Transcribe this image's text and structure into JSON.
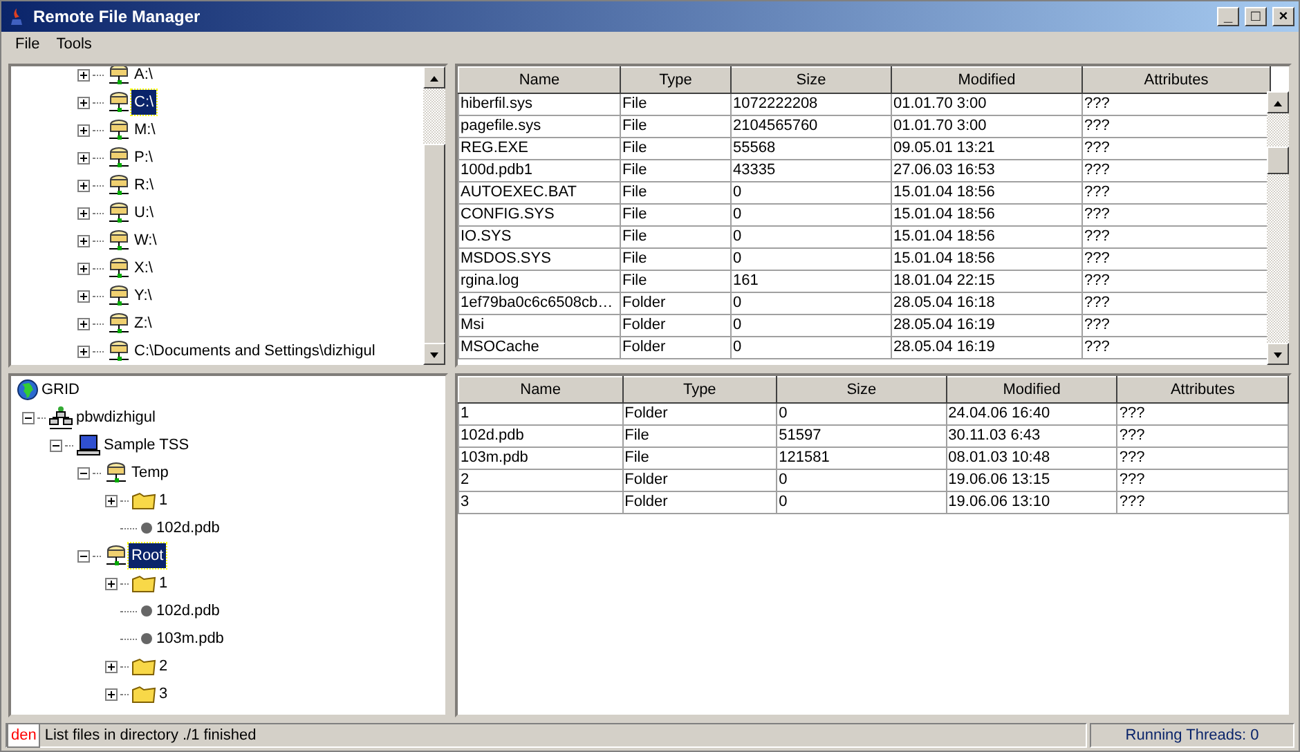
{
  "window": {
    "title": "Remote File Manager",
    "controls": [
      "_",
      "□",
      "×"
    ]
  },
  "menu": [
    "File",
    "Tools"
  ],
  "drive_tree": {
    "items": [
      {
        "label": "A:\\",
        "kind": "drive",
        "expanded": false,
        "selected": false
      },
      {
        "label": "C:\\",
        "kind": "drive",
        "expanded": false,
        "selected": true
      },
      {
        "label": "M:\\",
        "kind": "drive",
        "expanded": false,
        "selected": false
      },
      {
        "label": "P:\\",
        "kind": "drive",
        "expanded": false,
        "selected": false
      },
      {
        "label": "R:\\",
        "kind": "drive",
        "expanded": false,
        "selected": false
      },
      {
        "label": "U:\\",
        "kind": "drive",
        "expanded": false,
        "selected": false
      },
      {
        "label": "W:\\",
        "kind": "drive",
        "expanded": false,
        "selected": false
      },
      {
        "label": "X:\\",
        "kind": "drive",
        "expanded": false,
        "selected": false
      },
      {
        "label": "Y:\\",
        "kind": "drive",
        "expanded": false,
        "selected": false
      },
      {
        "label": "Z:\\",
        "kind": "drive",
        "expanded": false,
        "selected": false
      },
      {
        "label": "C:\\Documents and Settings\\dizhigul",
        "kind": "drive",
        "expanded": false,
        "selected": false
      }
    ]
  },
  "local_table": {
    "columns": [
      "Name",
      "Type",
      "Size",
      "Modified",
      "Attributes"
    ],
    "rows": [
      [
        "hiberfil.sys",
        "File",
        "1072222208",
        "01.01.70 3:00",
        "???"
      ],
      [
        "pagefile.sys",
        "File",
        "2104565760",
        "01.01.70 3:00",
        "???"
      ],
      [
        "REG.EXE",
        "File",
        "55568",
        "09.05.01 13:21",
        "???"
      ],
      [
        "100d.pdb1",
        "File",
        "43335",
        "27.06.03 16:53",
        "???"
      ],
      [
        "AUTOEXEC.BAT",
        "File",
        "0",
        "15.01.04 18:56",
        "???"
      ],
      [
        "CONFIG.SYS",
        "File",
        "0",
        "15.01.04 18:56",
        "???"
      ],
      [
        "IO.SYS",
        "File",
        "0",
        "15.01.04 18:56",
        "???"
      ],
      [
        "MSDOS.SYS",
        "File",
        "0",
        "15.01.04 18:56",
        "???"
      ],
      [
        "rgina.log",
        "File",
        "161",
        "18.01.04 22:15",
        "???"
      ],
      [
        "1ef79ba0c6c6508cb…",
        "Folder",
        "0",
        "28.05.04 16:18",
        "???"
      ],
      [
        "Msi",
        "Folder",
        "0",
        "28.05.04 16:19",
        "???"
      ],
      [
        "MSOCache",
        "Folder",
        "0",
        "28.05.04 16:19",
        "???"
      ]
    ]
  },
  "grid_tree": {
    "items": [
      {
        "label": "GRID",
        "kind": "globe",
        "selected": false,
        "children": [
          {
            "label": "pbwdizhigul",
            "kind": "network",
            "expanded": true,
            "selected": false,
            "children": [
              {
                "label": "Sample TSS",
                "kind": "computer",
                "expanded": true,
                "selected": false,
                "children": [
                  {
                    "label": "Temp",
                    "kind": "drive",
                    "expanded": true,
                    "selected": false,
                    "children": [
                      {
                        "label": "1",
                        "kind": "folder",
                        "expanded": false,
                        "selected": false
                      },
                      {
                        "label": "102d.pdb",
                        "kind": "file",
                        "selected": false
                      }
                    ]
                  },
                  {
                    "label": "Root",
                    "kind": "drive",
                    "expanded": true,
                    "selected": true,
                    "children": [
                      {
                        "label": "1",
                        "kind": "folder",
                        "expanded": false,
                        "selected": false
                      },
                      {
                        "label": "102d.pdb",
                        "kind": "file",
                        "selected": false
                      },
                      {
                        "label": "103m.pdb",
                        "kind": "file",
                        "selected": false
                      },
                      {
                        "label": "2",
                        "kind": "folder",
                        "expanded": false,
                        "selected": false
                      },
                      {
                        "label": "3",
                        "kind": "folder",
                        "expanded": false,
                        "selected": false
                      }
                    ]
                  }
                ]
              }
            ]
          }
        ]
      }
    ]
  },
  "remote_table": {
    "columns": [
      "Name",
      "Type",
      "Size",
      "Modified",
      "Attributes"
    ],
    "rows": [
      [
        "1",
        "Folder",
        "0",
        "24.04.06 16:40",
        "???"
      ],
      [
        "102d.pdb",
        "File",
        "51597",
        "30.11.03 6:43",
        "???"
      ],
      [
        "103m.pdb",
        "File",
        "121581",
        "08.01.03 10:48",
        "???"
      ],
      [
        "2",
        "Folder",
        "0",
        "19.06.06 13:15",
        "???"
      ],
      [
        "3",
        "Folder",
        "0",
        "19.06.06 13:10",
        "???"
      ]
    ]
  },
  "status_bar": {
    "tag": "den",
    "message": "List files in directory ./1 finished",
    "threads": "Running Threads: 0"
  }
}
